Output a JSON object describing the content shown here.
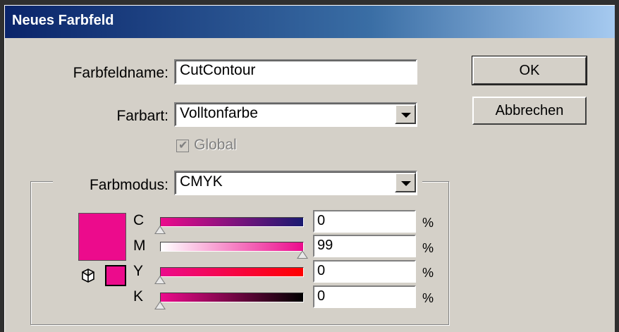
{
  "dialog": {
    "title": "Neues Farbfeld"
  },
  "form": {
    "swatch_name_label": "Farbfeldname:",
    "swatch_name_value": "CutContour",
    "color_type_label": "Farbart:",
    "color_type_value": "Volltonfarbe",
    "global_label": "Global",
    "color_mode_label": "Farbmodus:",
    "color_mode_value": "CMYK"
  },
  "buttons": {
    "ok": "OK",
    "cancel": "Abbrechen"
  },
  "channels": [
    {
      "label": "C",
      "value": "0",
      "unit": "%"
    },
    {
      "label": "M",
      "value": "99",
      "unit": "%"
    },
    {
      "label": "Y",
      "value": "0",
      "unit": "%"
    },
    {
      "label": "K",
      "value": "0",
      "unit": "%"
    }
  ],
  "colors": {
    "swatch": "#ec0b8c",
    "title_start": "#0a246a",
    "title_end": "#a6caf0"
  },
  "icons": {
    "gamut": "cube-icon",
    "global_check": "check-icon",
    "dropdown": "chevron-down-icon"
  }
}
